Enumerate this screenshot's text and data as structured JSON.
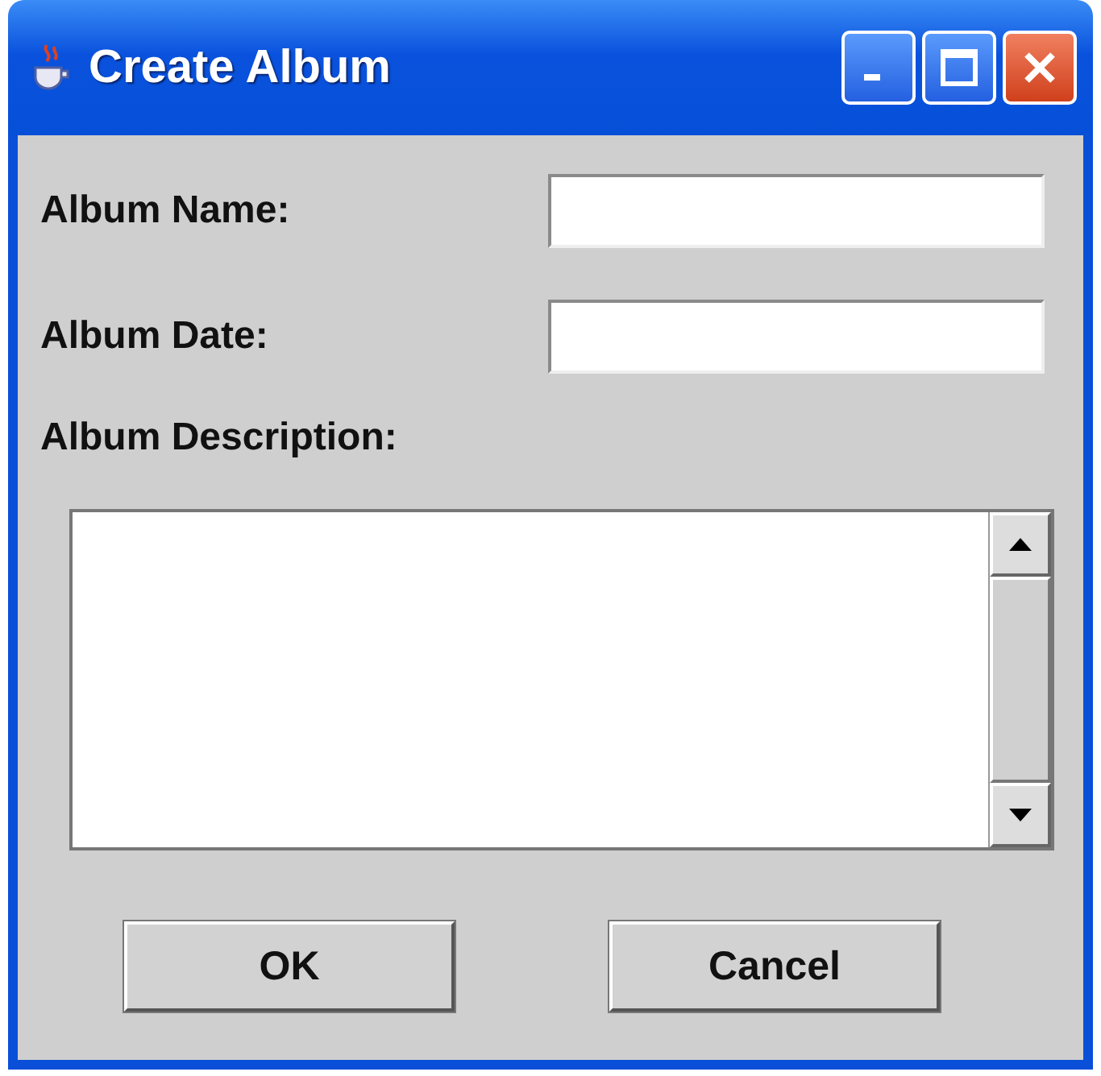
{
  "window": {
    "title": "Create Album"
  },
  "fields": [
    {
      "label": "Album Name:"
    },
    {
      "label": "Album Date:"
    }
  ],
  "description": {
    "label": "Album Description:"
  },
  "buttons": [
    "OK",
    "Cancel"
  ]
}
